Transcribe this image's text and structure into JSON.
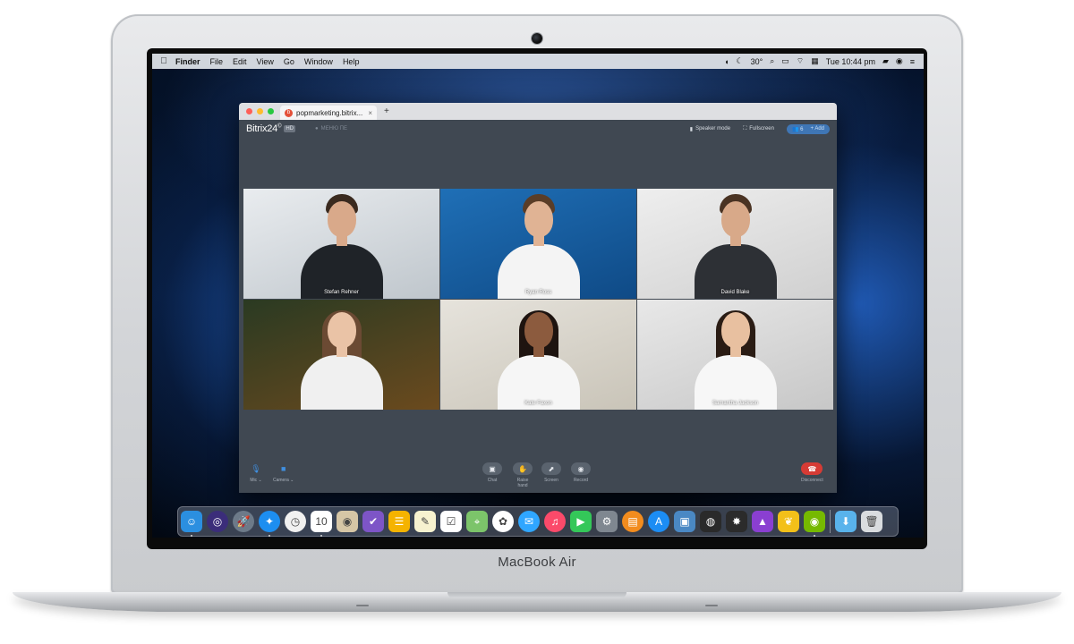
{
  "menubar": {
    "apple_icon": "",
    "items": [
      "Finder",
      "File",
      "Edit",
      "View",
      "Go",
      "Window",
      "Help"
    ],
    "temperature": "30°",
    "clock": "Tue 10:44 pm"
  },
  "browser": {
    "tab_title": "popmarketing.bitrix...",
    "tab_close": "×",
    "new_tab": "+",
    "traffic_lights": [
      "#fe5f57",
      "#febc2e",
      "#28c840"
    ]
  },
  "call": {
    "logo": "Bitrix24",
    "logo_suffix": "©",
    "hd_badge": "HD",
    "location": "МЕНЮ ПЕ",
    "speaker_mode": "Speaker mode",
    "fullscreen": "Fullscreen",
    "users_count": "6",
    "add_label": "+ Add",
    "participants": [
      {
        "name": "Stefan Rehner",
        "bg": [
          "#e9ecef",
          "#bfc6cc"
        ],
        "skin": "#d9a98a",
        "hair": "#3a2a1f",
        "shirt": "#1f2328"
      },
      {
        "name": "Ryan Ross",
        "bg": [
          "#1f6fb6",
          "#0f4a86"
        ],
        "skin": "#e0b394",
        "hair": "#5a3d27",
        "shirt": "#f4f4f4"
      },
      {
        "name": "David Blake",
        "bg": [
          "#eeeeee",
          "#d0d0d0"
        ],
        "skin": "#d8a989",
        "hair": "#4a3323",
        "shirt": "#2d3035"
      },
      {
        "name": "",
        "bg": [
          "#2a3a22",
          "#6b4a1e"
        ],
        "skin": "#eac3a6",
        "hair": "#6b4a33",
        "shirt": "#f0f0f0"
      },
      {
        "name": "Kate Faxon",
        "bg": [
          "#e6e3dc",
          "#c9c4b8"
        ],
        "skin": "#8c5b3e",
        "hair": "#1e1410",
        "shirt": "#f6f6f6"
      },
      {
        "name": "Samantha Jackson",
        "bg": [
          "#e8e8e8",
          "#c7c7c7"
        ],
        "skin": "#e8c0a0",
        "hair": "#2a1c14",
        "shirt": "#f7f7f7"
      }
    ],
    "controls": {
      "mic": "Mic",
      "camera": "Camera",
      "chat": "Chat",
      "raise_hand": "Raise hand",
      "screen": "Screen",
      "record": "Record",
      "disconnect": "Disconnect"
    }
  },
  "dock": [
    {
      "name": "finder-icon",
      "color": "#2b8fe0",
      "glyph": "☺",
      "dot": true
    },
    {
      "name": "siri-icon",
      "color": "#3b2d7a",
      "glyph": "◎",
      "round": true
    },
    {
      "name": "launchpad-icon",
      "color": "#6d7a89",
      "glyph": "🚀",
      "round": true
    },
    {
      "name": "safari-icon",
      "color": "#1d8ef0",
      "glyph": "✦",
      "round": true,
      "dot": true
    },
    {
      "name": "clock-icon",
      "color": "#f1f1f1",
      "glyph": "◷",
      "round": true
    },
    {
      "name": "calendar-icon",
      "color": "#ffffff",
      "glyph": "10",
      "dot": true
    },
    {
      "name": "contacts-icon",
      "color": "#d6c6a6",
      "glyph": "◉"
    },
    {
      "name": "tasks-icon",
      "color": "#7d55c7",
      "glyph": "✔"
    },
    {
      "name": "notes-list-icon",
      "color": "#f5b300",
      "glyph": "☰"
    },
    {
      "name": "notes-icon",
      "color": "#f7f2d0",
      "glyph": "✎"
    },
    {
      "name": "reminders-icon",
      "color": "#ffffff",
      "glyph": "☑"
    },
    {
      "name": "maps-icon",
      "color": "#7cc46a",
      "glyph": "⌖"
    },
    {
      "name": "photos-icon",
      "color": "#fefefe",
      "glyph": "✿",
      "round": true
    },
    {
      "name": "messages-icon",
      "color": "#2fa6ff",
      "glyph": "✉",
      "round": true
    },
    {
      "name": "music-icon",
      "color": "#fb4a6a",
      "glyph": "♫",
      "round": true
    },
    {
      "name": "facetime-icon",
      "color": "#34c759",
      "glyph": "▶"
    },
    {
      "name": "preferences-icon",
      "color": "#7f8790",
      "glyph": "⚙"
    },
    {
      "name": "books-icon",
      "color": "#f28c1e",
      "glyph": "▤",
      "round": true
    },
    {
      "name": "appstore-icon",
      "color": "#1c8df4",
      "glyph": "A",
      "round": true
    },
    {
      "name": "migration-icon",
      "color": "#4a88c4",
      "glyph": "▣"
    },
    {
      "name": "disk-icon",
      "color": "#2a2a2a",
      "glyph": "◍"
    },
    {
      "name": "video-editor-icon",
      "color": "#2b2b2b",
      "glyph": "✸"
    },
    {
      "name": "affinity-icon",
      "color": "#8a3fd1",
      "glyph": "▲"
    },
    {
      "name": "butterfly-icon",
      "color": "#f3c019",
      "glyph": "❦"
    },
    {
      "name": "nvidia-icon",
      "color": "#76b900",
      "glyph": "◉",
      "dot": true
    }
  ],
  "dock_right": [
    {
      "name": "downloads-folder-icon",
      "color": "#59b3ec",
      "glyph": "⬇"
    },
    {
      "name": "trash-icon",
      "color": "#d9dcdf",
      "glyph": "🗑"
    }
  ],
  "laptop_brand": "MacBook Air"
}
